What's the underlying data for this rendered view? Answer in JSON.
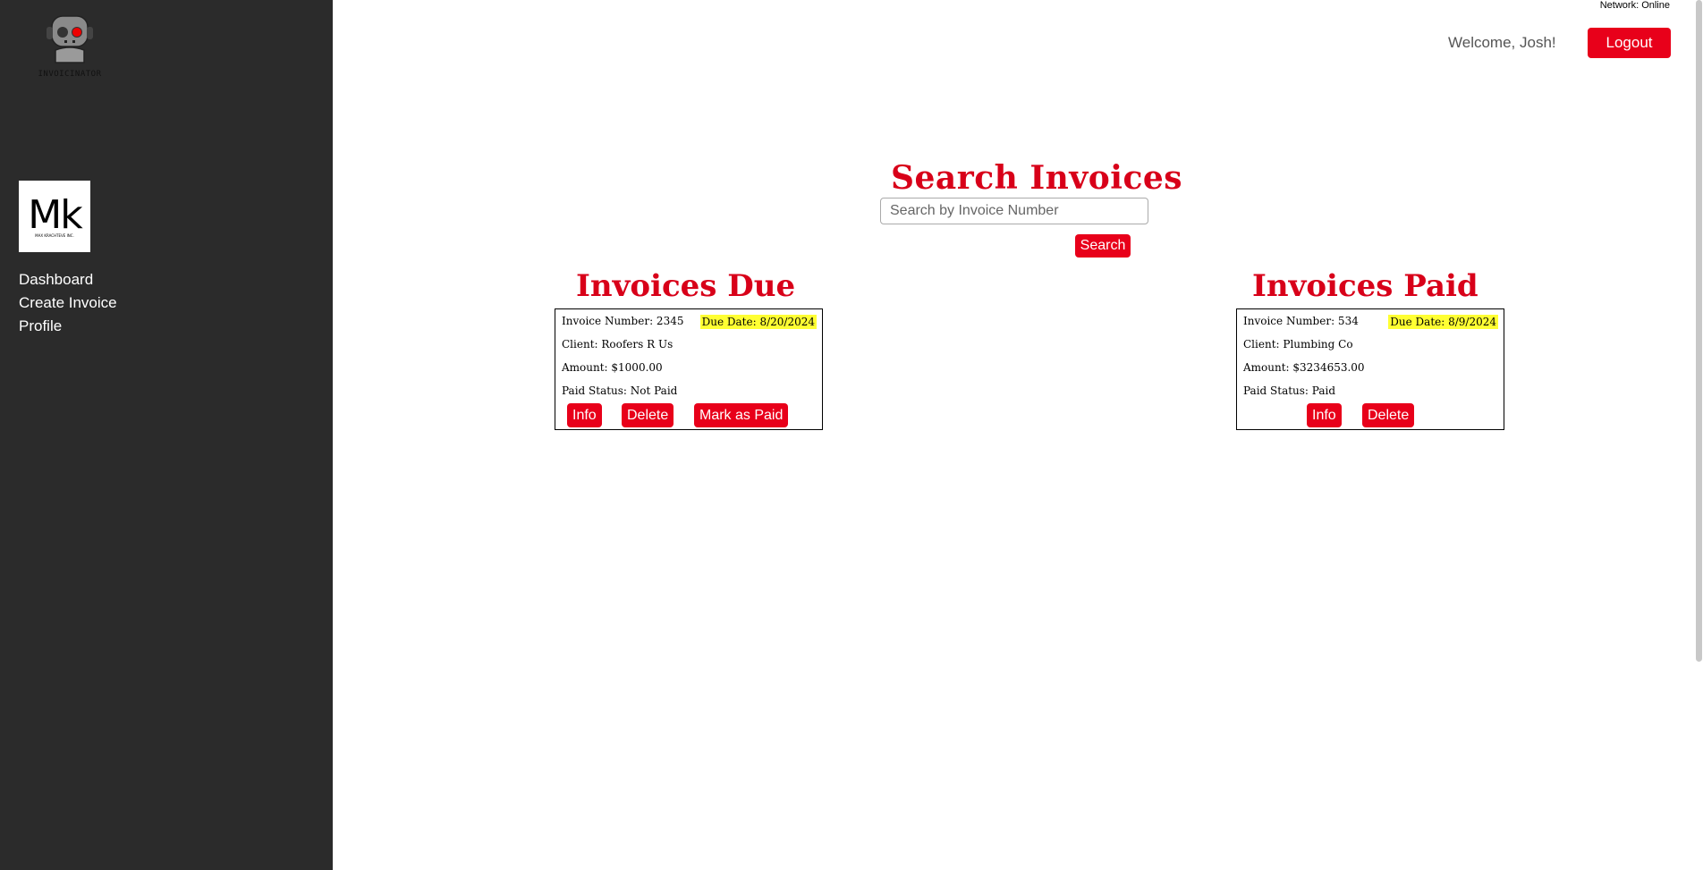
{
  "app": {
    "logo_text": "INVOICINATOR",
    "company_logo_text": "Mk",
    "company_logo_subtext": "MAX KRACHTEVE INC."
  },
  "sidebar": {
    "items": [
      {
        "label": "Dashboard"
      },
      {
        "label": "Create Invoice"
      },
      {
        "label": "Profile"
      }
    ]
  },
  "header": {
    "network_status": "Network: Online",
    "welcome": "Welcome, Josh!",
    "logout_label": "Logout"
  },
  "search": {
    "title": "Search Invoices",
    "placeholder": "Search by Invoice Number",
    "button_label": "Search"
  },
  "due": {
    "title": "Invoices Due",
    "invoices": [
      {
        "number": "Invoice Number: 2345",
        "due_date": "Due Date: 8/20/2024",
        "client": "Client: Roofers R Us",
        "amount": "Amount: $1000.00",
        "paid_status": "Paid Status: Not Paid",
        "info_label": "Info",
        "delete_label": "Delete",
        "mark_paid_label": "Mark as Paid"
      }
    ]
  },
  "paid": {
    "title": "Invoices Paid",
    "invoices": [
      {
        "number": "Invoice Number: 534",
        "due_date": "Due Date: 8/9/2024",
        "client": "Client: Plumbing Co",
        "amount": "Amount: $3234653.00",
        "paid_status": "Paid Status: Paid",
        "info_label": "Info",
        "delete_label": "Delete"
      }
    ]
  },
  "colors": {
    "accent": "#e8001a",
    "sidebar_bg": "#2b2b2b",
    "due_highlight": "#ffff33"
  }
}
